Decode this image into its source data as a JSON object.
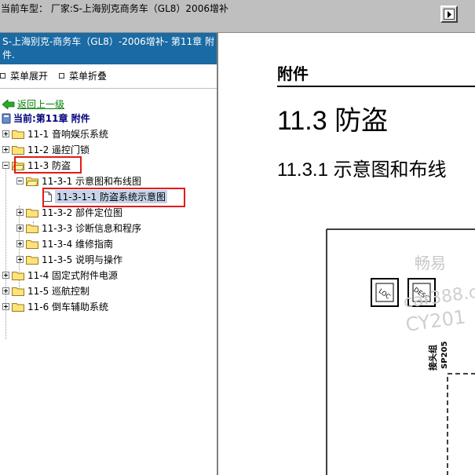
{
  "topbar": {
    "title": "当前车型：  厂家:S-上海别克商务车（GL8）2006增补"
  },
  "sidebar": {
    "header": "S-上海别克-商务车（GL8）-2006增补- 第11章 附件.",
    "expand_label": "菜单展开",
    "collapse_label": "菜单折叠",
    "back_label": "返回上一级",
    "current_label": "当前:第11章 附件",
    "tree": [
      {
        "label": "11-1 音响娱乐系统"
      },
      {
        "label": "11-2 遥控门锁"
      },
      {
        "label": "11-3 防盗"
      },
      {
        "label": "11-3-1 示意图和布线图"
      },
      {
        "label": "11-3-1-1 防盗系统示意图"
      },
      {
        "label": "11-3-2 部件定位图"
      },
      {
        "label": "11-3-3 诊断信息和程序"
      },
      {
        "label": "11-3-4 维修指南"
      },
      {
        "label": "11-3-5 说明与操作"
      },
      {
        "label": "11-4 固定式附件电源"
      },
      {
        "label": "11-5 巡航控制"
      },
      {
        "label": "11-6 倒车辅助系统"
      }
    ]
  },
  "document": {
    "section_small": "附件",
    "section_big": "11.3 防盗",
    "section_mid": "11.3.1 示意图和布线",
    "box_loc": "LOC",
    "box_desc": "DESC",
    "connector_label": "接头组",
    "connector_code": "SP205",
    "watermark_1": "畅易",
    "watermark_2": "car388.c",
    "watermark_3": "CY201"
  },
  "colors": {
    "header_bg": "#1a6aa4",
    "highlight_box": "#e31a1a",
    "back_link": "#008000"
  }
}
